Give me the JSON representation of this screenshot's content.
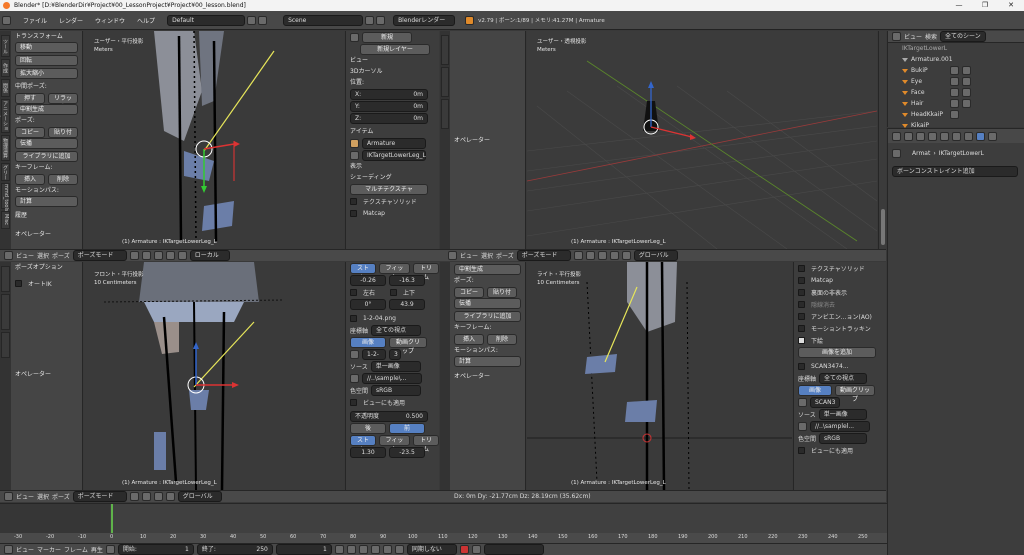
{
  "window": {
    "title": "Blender* [D:¥BlenderDir¥Project¥00_LessonProject¥Project¥00_lesson.blend]",
    "controls": [
      "—",
      "❐",
      "✕"
    ]
  },
  "menubar": {
    "items": [
      "ファイル",
      "レンダー",
      "ウィンドウ",
      "ヘルプ"
    ],
    "layout": "Default",
    "scene": "Scene",
    "engine": "Blenderレンダー",
    "stats": "v2.79 | ボーン:1/89 | メモリ:41.27M | Armature"
  },
  "tool_shelf": {
    "title": "トランスフォーム",
    "transform_buttons": [
      "移動",
      "回転",
      "拡大縮小"
    ],
    "pose_section": "中間ポーズ:",
    "pose_buttons": [
      "押す",
      "リラック"
    ],
    "breakdown": "中割生成",
    "pose_label": "ポーズ:",
    "copy": "コピー",
    "paste": "貼り付け",
    "propagate": "伝播",
    "add_library": "ライブラリに追加",
    "keyframe_label": "キーフレーム:",
    "insert": "挿入",
    "delete": "削除",
    "motion_path_label": "モーションパス:",
    "calculate": "計算",
    "history": "履歴",
    "operator": "オペレーター"
  },
  "tool_shelf_bottom": {
    "header": "ポーズオプション",
    "auto_ik": "オートIK",
    "operator": "オペレーター"
  },
  "vertical_tabs_left": [
    "ツール",
    "作成",
    "関係",
    "アニメーション",
    "物理演算",
    "グリースペンシル",
    "mmd_tools",
    "Misc"
  ],
  "viewport_top_left": {
    "label": "ユーザー・平行投影",
    "units": "Meters",
    "status": "(1) Armature : IKTargetLowerLeg_L"
  },
  "viewport_top_right": {
    "label": "ユーザー・透視投影",
    "units": "Meters",
    "status": "(1) Armature : IKTargetLowerLeg_L"
  },
  "viewport_bottom_left": {
    "label": "フロント・平行投影",
    "units": "10 Centimeters",
    "status": "(1) Armature : IKTargetLowerLeg_L"
  },
  "viewport_bottom_right": {
    "label": "ライト・平行投影",
    "units": "10 Centimeters",
    "status": "(1) Armature : IKTargetLowerLeg_L"
  },
  "n_panel_top": {
    "new": "新規",
    "new_layer": "新規レイヤー",
    "view": "ビュー",
    "cursor": "3Dカーソル",
    "location": "位置:",
    "x": "X:",
    "y": "Y:",
    "z": "Z:",
    "x_val": "0m",
    "y_val": "0m",
    "z_val": "0m",
    "item": "アイテム",
    "armature": "Armature",
    "bone": "IKTargetLowerLeg_L",
    "display": "表示",
    "shading": "シェーディング",
    "multitexture": "マルチテクスチャ",
    "texture_solid": "テクスチャソリッド",
    "matcap": "Matcap"
  },
  "n_panel_bottom": {
    "tab_stretch": "ストレ",
    "tab_fit": "フィット",
    "tab_crop": "トリム",
    "v1": "-0.26",
    "v2": "-16.3",
    "flip_x": "左右",
    "flip_y": "上下",
    "v3": "0°",
    "v4": "43.9",
    "image_name": "1-2-04.png",
    "coords_label": "座標軸",
    "coords_value": "全ての視点",
    "image": "画像",
    "movie": "動画クリップ",
    "image_short": "1-2-",
    "num": "3",
    "source_label": "ソース",
    "source_value": "単一画像",
    "path": "//..\\sample\\...",
    "colorspace_label": "色空間",
    "colorspace_value": "sRGB",
    "view_as_render": "ビューにも適用",
    "opacity_label": "不透明度",
    "opacity_value": "0.500",
    "back": "後",
    "front": "前",
    "v5": "1.30",
    "v6": "-23.5"
  },
  "tool_shelf_mid": {
    "breakdown": "中割生成",
    "pose_label": "ポーズ:",
    "copy": "コピー",
    "paste": "貼り付け",
    "propagate": "伝播",
    "add_library": "ライブラリに追加",
    "keyframe_label": "キーフレーム:",
    "insert": "挿入",
    "delete": "削除",
    "motion_path_label": "モーションパス:",
    "calculate": "計算",
    "operator": "オペレーター"
  },
  "n_panel_right": {
    "texture_solid": "テクスチャソリッド",
    "matcap": "Matcap",
    "backface": "裏面の非表示",
    "wire": "隠線消去",
    "ao": "アンビエン...ョン(AO)",
    "motion_tracking": "モーショントラッキン",
    "background": "下絵",
    "add_image": "画像を追加",
    "scan_name": "SCAN3474...",
    "coords_label": "座標軸",
    "coords_value": "全ての視点",
    "image": "画像",
    "movie": "動画クリップ",
    "scan_short": "SCAN3",
    "source_label": "ソース",
    "source_value": "単一画像",
    "path": "//..\\samplel...",
    "colorspace_label": "色空間",
    "colorspace_value": "sRGB",
    "view_as_render": "ビューにも適用"
  },
  "viewport_header_tl": {
    "view": "ビュー",
    "select": "選択",
    "pose": "ポーズ",
    "mode": "ポーズモード",
    "orientation": "ローカル"
  },
  "viewport_header_tr": {
    "view": "ビュー",
    "select": "選択",
    "pose": "ポーズ",
    "mode": "ポーズモード",
    "orientation": "グローバル"
  },
  "viewport_header_bl": {
    "view": "ビュー",
    "select": "選択",
    "pose": "ポーズ",
    "mode": "ポーズモード",
    "orientation": "グローバル"
  },
  "footer_status": {
    "text": "Dx: 0m  Dy: -21.77cm  Dz: 28.19cm (35.62cm)"
  },
  "outliner": {
    "view": "ビュー",
    "search": "検索",
    "filter": "全てのシーン",
    "items": [
      "IKTargetLowerL",
      "Armature.001",
      "BukiP",
      "Eye",
      "Face",
      "Hair",
      "HeadKkaiP",
      "KikaiP"
    ]
  },
  "properties": {
    "armature": "Armat",
    "bone": "IKTargetLowerL",
    "add_constraint": "ボーンコンストレイント追加"
  },
  "timeline": {
    "ticks": [
      "-30",
      "-20",
      "-10",
      "0",
      "10",
      "20",
      "30",
      "40",
      "50",
      "60",
      "70",
      "80",
      "90",
      "100",
      "110",
      "120",
      "130",
      "140",
      "150",
      "160",
      "170",
      "180",
      "190",
      "200",
      "210",
      "220",
      "230",
      "240",
      "250"
    ],
    "view": "ビュー",
    "marker": "マーカー",
    "frame": "フレーム",
    "playback": "再生",
    "start_label": "開始:",
    "start": "1",
    "end_label": "終了:",
    "end": "250",
    "current": "1",
    "sync": "同期しない"
  }
}
